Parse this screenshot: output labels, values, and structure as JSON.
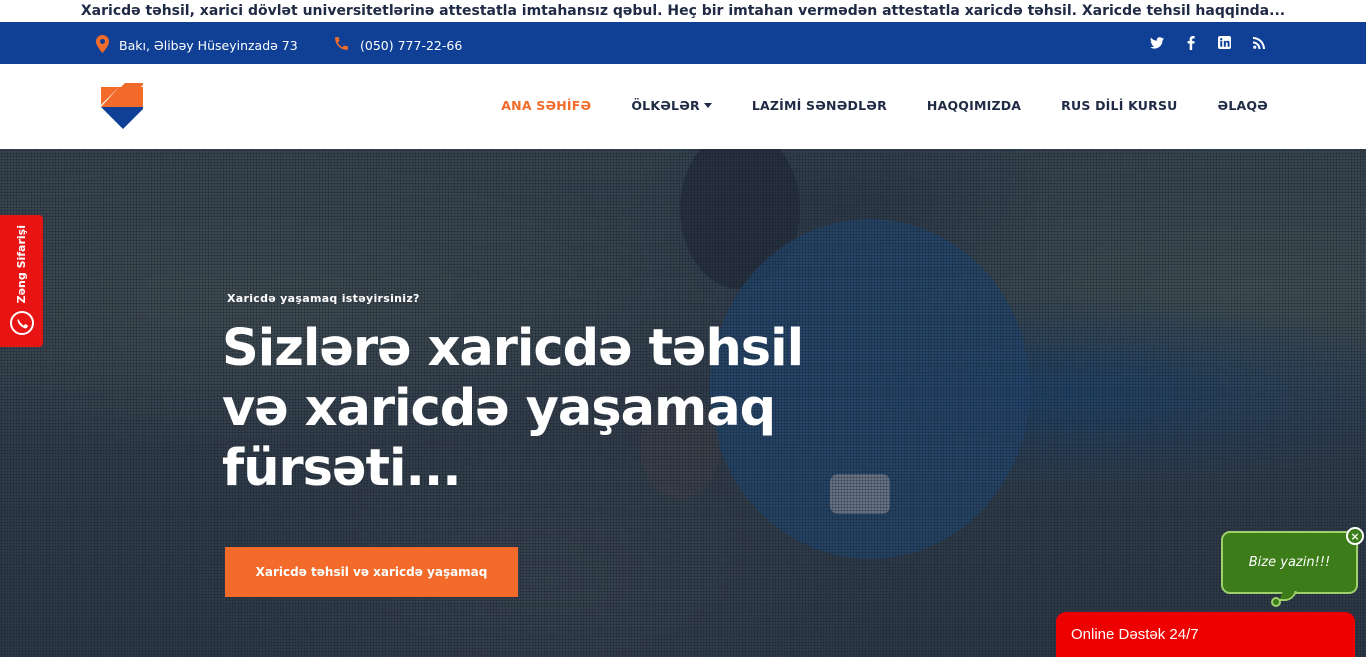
{
  "ticker": {
    "text": "Xaricdə təhsil, xarici dövlət universitetlərinə attestatla imtahansız qəbul. Heç bir imtahan vermədən attestatla xaricdə təhsil. Xaricde tehsil haqqinda..."
  },
  "topbar": {
    "address": "Bakı, Əlibəy Hüseyinzadə 73",
    "phone": "(050) 777-22-66",
    "socials": [
      "twitter-icon",
      "facebook-icon",
      "linkedin-icon",
      "rss-icon"
    ]
  },
  "nav": {
    "items": [
      {
        "label": "ANA SƏHİFƏ",
        "active": true
      },
      {
        "label": "ÖLKƏLƏR",
        "has_dropdown": true
      },
      {
        "label": "LAZİMİ SƏNƏDLƏR"
      },
      {
        "label": "HAQQIMIZDA"
      },
      {
        "label": "RUS DİLİ KURSU"
      },
      {
        "label": "ƏLAQƏ"
      }
    ]
  },
  "hero": {
    "kicker": "Xaricdə yaşamaq istəyirsiniz?",
    "headline": "Sizlərə xaricdə təhsil və xaricdə yaşamaq fürsəti...",
    "cta_label": "Xaricdə təhsil və xaricdə yaşamaq"
  },
  "call_tab": {
    "label": "Zəng Sifarişi"
  },
  "chat_bubble": {
    "text": "Bize yazin!!!",
    "close": "×"
  },
  "support": {
    "label": "Online Dəstək 24/7"
  },
  "colors": {
    "brand_blue": "#0f4096",
    "accent_orange": "#f26b2a",
    "support_red": "#ee0000",
    "chat_green": "#3c7d1a"
  }
}
